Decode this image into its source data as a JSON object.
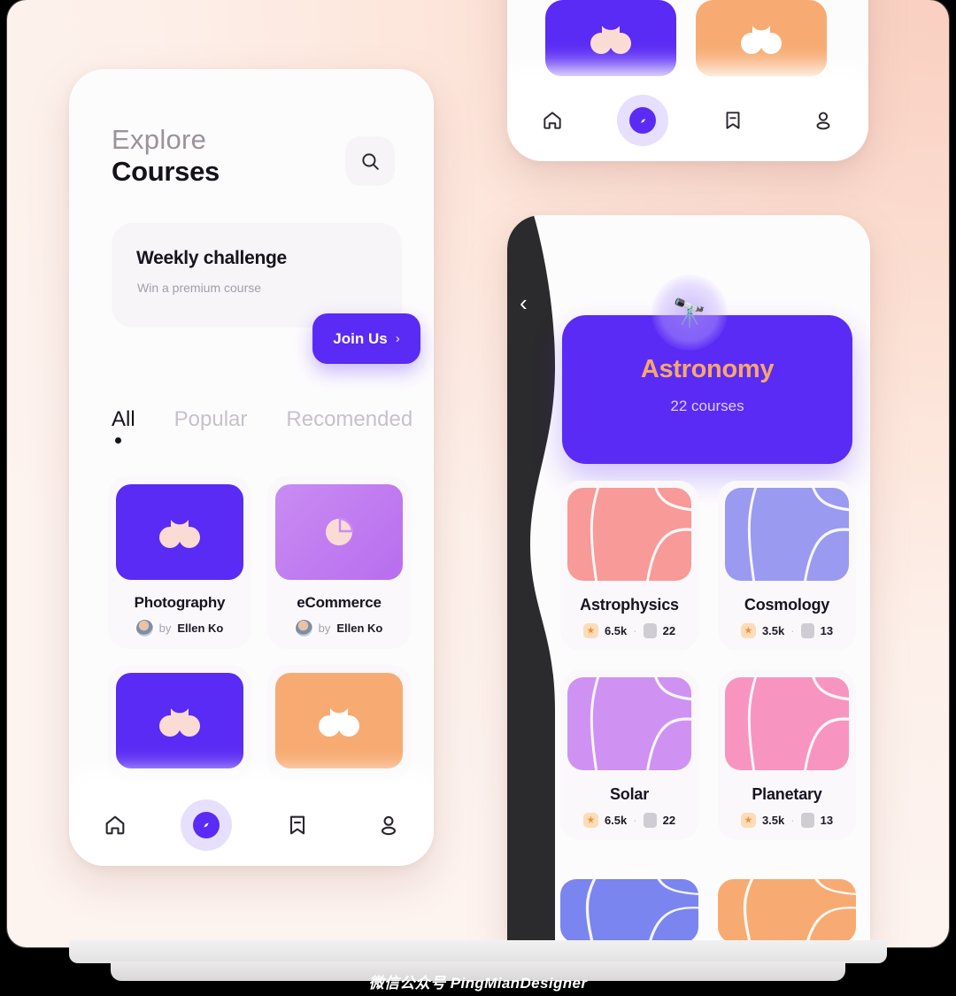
{
  "watermark": "微信公众号 PingMianDesigner",
  "colors": {
    "accent_purple": "#5a2bf5",
    "accent_orange": "#f9a769",
    "card_purple": "#5a2bf5",
    "card_light_purple": "#c07ff0",
    "card_peach": "#f7ab72",
    "bg_pink": "#fdf0ea"
  },
  "left_phone": {
    "header": {
      "eyebrow": "Explore",
      "title": "Courses",
      "search_icon": "search-icon"
    },
    "challenge": {
      "title": "Weekly challenge",
      "subtitle": "Win a premium course"
    },
    "join_button": {
      "label": "Join Us",
      "chevron": "›"
    },
    "tabs": [
      {
        "label": "All",
        "active": true
      },
      {
        "label": "Popular",
        "active": false
      },
      {
        "label": "Recomended",
        "active": false
      }
    ],
    "courses": [
      {
        "title": "Photography",
        "by_prefix": "by",
        "author": "Ellen Ko",
        "art": "purple",
        "icon": "camera-icon"
      },
      {
        "title": "eCommerce",
        "by_prefix": "by",
        "author": "Ellen Ko",
        "art": "lightpurple",
        "icon": "pie-chart-icon"
      },
      {
        "title": "",
        "by_prefix": "",
        "author": "",
        "art": "purple",
        "icon": "camera-icon"
      },
      {
        "title": "",
        "by_prefix": "",
        "author": "",
        "art": "peach",
        "icon": "camera-icon"
      }
    ],
    "nav": [
      {
        "name": "home",
        "active": false
      },
      {
        "name": "explore",
        "active": true
      },
      {
        "name": "bookmark",
        "active": false
      },
      {
        "name": "profile",
        "active": false
      }
    ]
  },
  "top_right_phone": {
    "cards": [
      {
        "art": "purple",
        "icon": "camera-icon"
      },
      {
        "art": "peach",
        "icon": "camera-icon"
      }
    ],
    "nav": [
      {
        "name": "home",
        "active": false
      },
      {
        "name": "explore",
        "active": true
      },
      {
        "name": "bookmark",
        "active": false
      },
      {
        "name": "profile",
        "active": false
      }
    ]
  },
  "right_phone": {
    "back_chevron": "‹",
    "hero": {
      "title": "Astronomy",
      "subtitle": "22 courses",
      "badge_icon": "🔭"
    },
    "courses": [
      {
        "title": "Astrophysics",
        "likes": "6.5k",
        "lessons": "22",
        "sep": "·",
        "art": "salmon"
      },
      {
        "title": "Cosmology",
        "likes": "3.5k",
        "lessons": "13",
        "sep": "·",
        "art": "periwinkle"
      },
      {
        "title": "Solar",
        "likes": "6.5k",
        "lessons": "22",
        "sep": "·",
        "art": "orchid"
      },
      {
        "title": "Planetary",
        "likes": "3.5k",
        "lessons": "13",
        "sep": "·",
        "art": "pink"
      }
    ],
    "partial_courses": [
      {
        "art": "blue"
      },
      {
        "art": "peach"
      }
    ]
  }
}
